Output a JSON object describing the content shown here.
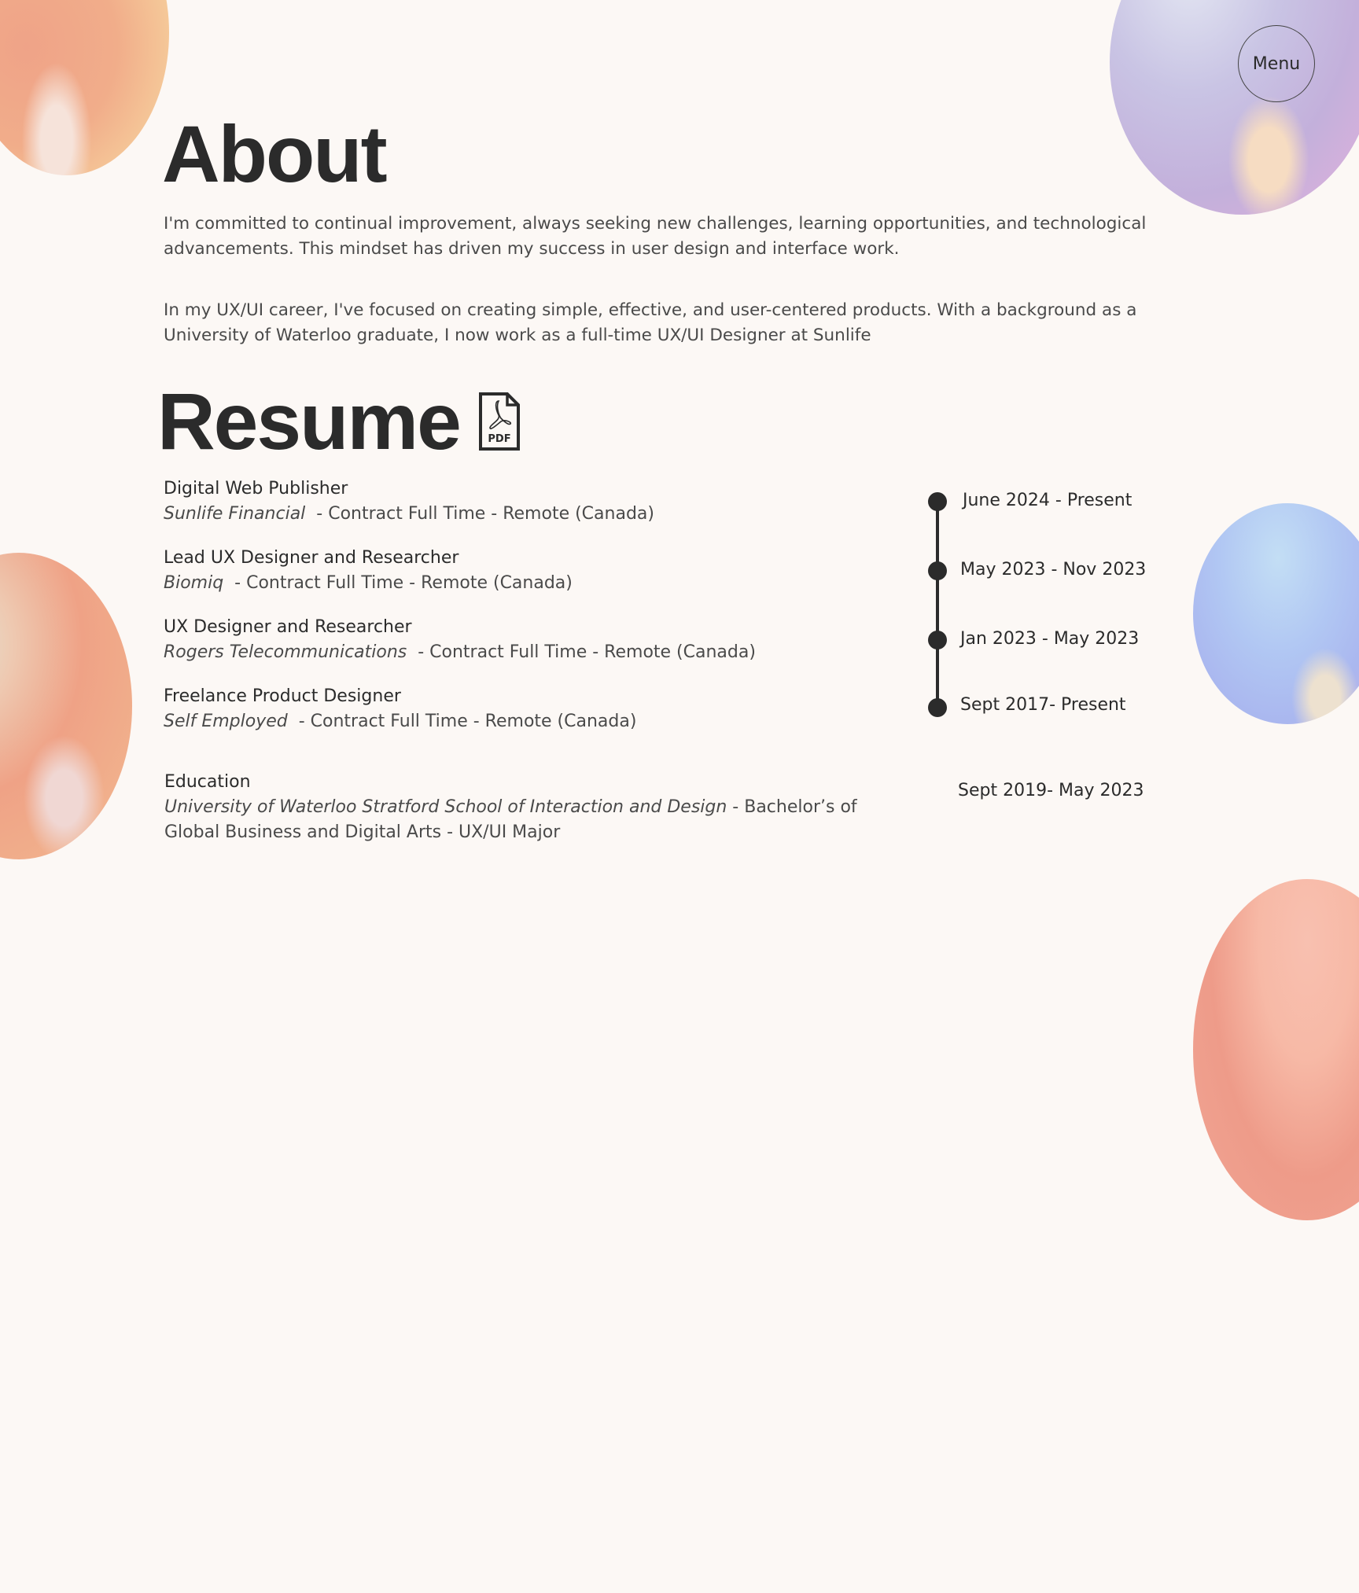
{
  "header": {
    "menu_label": "Menu"
  },
  "about": {
    "title": "About",
    "paragraphs": [
      "I'm committed to continual improvement, always seeking new challenges, learning opportunities, and technological advancements. This mindset has driven my success in user design and interface work.",
      "In my UX/UI career, I've focused on creating simple, effective, and user-centered products. With a background as a University of Waterloo graduate, I now work as a full-time UX/UI Designer at Sunlife"
    ]
  },
  "resume": {
    "title": "Resume",
    "pdf_icon": "pdf-file-icon",
    "pdf_icon_label": "PDF",
    "jobs": [
      {
        "title": "Digital Web Publisher",
        "company": "Sunlife Financial",
        "details": "  - Contract Full Time - Remote (Canada)",
        "dates": "June 2024 - Present"
      },
      {
        "title": "Lead UX Designer and Researcher",
        "company": "Biomiq",
        "details": "  - Contract Full Time - Remote (Canada)",
        "dates": "May 2023 - Nov 2023"
      },
      {
        "title": "UX Designer and Researcher",
        "company": "Rogers Telecommunications",
        "details": "  - Contract Full Time - Remote (Canada)",
        "dates": "Jan 2023 - May 2023"
      },
      {
        "title": "Freelance Product Designer",
        "company": "Self Employed",
        "details": "  - Contract Full Time - Remote (Canada)",
        "dates": "Sept 2017- Present"
      }
    ],
    "education": {
      "title": "Education",
      "school": "University of Waterloo Stratford School of Interaction and Design",
      "details": " - Bachelor’s of Global Business and Digital Arts - UX/UI Major",
      "dates": "Sept 2019- May 2023"
    }
  },
  "colors": {
    "background": "#fcf8f5",
    "text": "#2b2b2b",
    "body_text": "#4a4a4a"
  }
}
